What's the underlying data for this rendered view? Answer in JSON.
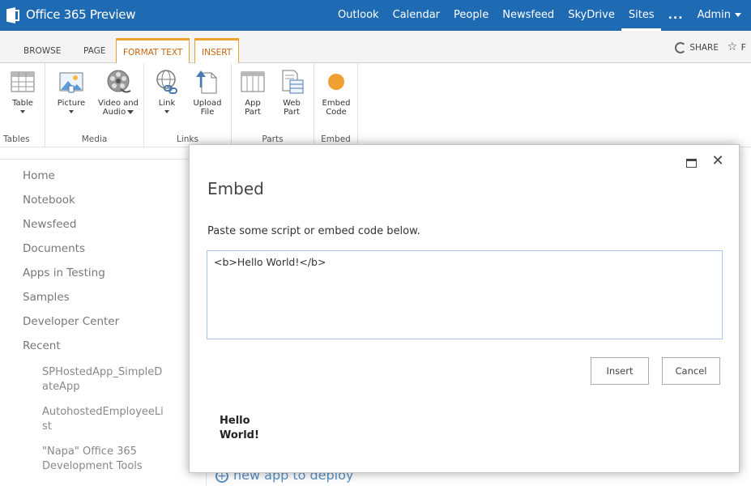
{
  "suitebar": {
    "title": "Office 365 Preview",
    "nav": [
      "Outlook",
      "Calendar",
      "People",
      "Newsfeed",
      "SkyDrive",
      "Sites"
    ],
    "more": "...",
    "admin": "Admin"
  },
  "ribbon": {
    "tabs": {
      "browse": "BROWSE",
      "page": "PAGE",
      "format_text": "FORMAT TEXT",
      "insert": "INSERT"
    },
    "share": "SHARE",
    "follow": "F",
    "groups": {
      "tables": {
        "label": "Tables",
        "table": "Table"
      },
      "media": {
        "label": "Media",
        "picture": "Picture",
        "video_line1": "Video and",
        "video_line2": "Audio"
      },
      "links": {
        "label": "Links",
        "link": "Link",
        "upload_line1": "Upload",
        "upload_line2": "File"
      },
      "parts": {
        "label": "Parts",
        "app_line1": "App",
        "app_line2": "Part",
        "web_line1": "Web",
        "web_line2": "Part"
      },
      "embed": {
        "label": "Embed",
        "line1": "Embed",
        "line2": "Code"
      }
    },
    "accent": "#f0a030"
  },
  "leftnav": {
    "items": [
      "Home",
      "Notebook",
      "Newsfeed",
      "Documents",
      "Apps in Testing",
      "Samples",
      "Developer Center",
      "Recent"
    ],
    "recent": [
      {
        "line1": "SPHostedApp_SimpleD",
        "line2": "ateApp"
      },
      {
        "line1": "AutohostedEmployeeLi",
        "line2": "st"
      },
      {
        "line1": "\"Napa\" Office 365",
        "line2": "Development Tools"
      }
    ]
  },
  "background_link": "new app to deploy",
  "dialog": {
    "title": "Embed",
    "instructions": "Paste some script or embed code below.",
    "code_value": "<b>Hello World!</b>",
    "insert_label": "Insert",
    "cancel_label": "Cancel",
    "preview_line1": "Hello",
    "preview_line2": "World!"
  },
  "colors": {
    "suitebar": "#1f6bb3",
    "embed_dot": "#f0a030"
  }
}
